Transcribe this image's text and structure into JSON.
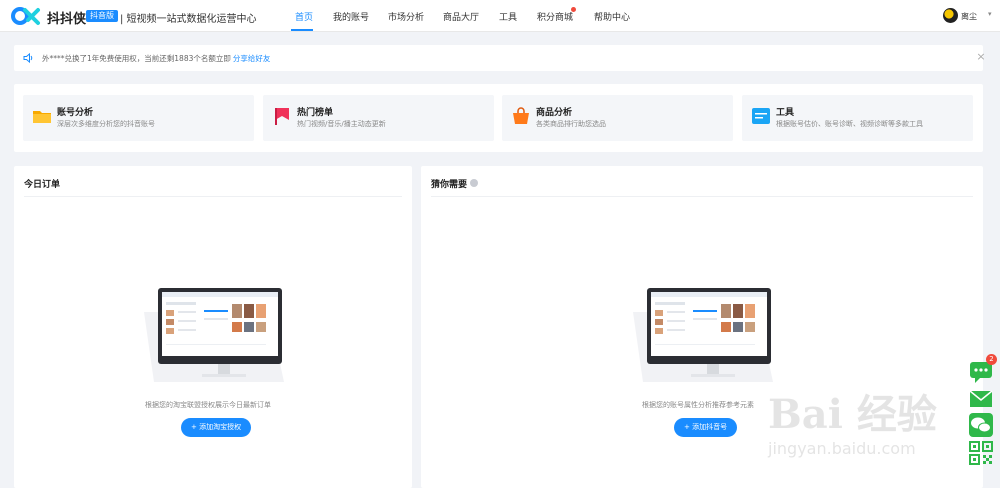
{
  "header": {
    "brand": "抖抖侠",
    "badge": "抖音版",
    "slogan": "| 短视频一站式数据化运营中心",
    "nav": [
      {
        "label": "首页"
      },
      {
        "label": "我的账号"
      },
      {
        "label": "市场分析"
      },
      {
        "label": "商品大厅"
      },
      {
        "label": "工具"
      },
      {
        "label": "积分商城"
      },
      {
        "label": "帮助中心"
      }
    ],
    "active_nav": "首页",
    "user_name": "离尘",
    "caret": "▾",
    "accent_color": "#1a8cff"
  },
  "notice": {
    "text": "外****兑换了1年免费使用权，当前还剩1883个名额立即",
    "link": "分享给好友",
    "close": "×"
  },
  "features": [
    {
      "title": "账号分析",
      "desc": "深层次多维度分析您的抖音账号",
      "icon": "folder-icon"
    },
    {
      "title": "热门榜单",
      "desc": "热门视频/音乐/播主动态更新",
      "icon": "flag-icon"
    },
    {
      "title": "商品分析",
      "desc": "各类商品排行助您选品",
      "icon": "shopping-bag-icon"
    },
    {
      "title": "工具",
      "desc": "根据账号估价、账号诊断、视频诊断等多款工具",
      "icon": "toolbox-icon"
    }
  ],
  "panels": {
    "orders": {
      "title": "今日订单",
      "empty_text": "根据您的淘宝联盟授权展示今日最新订单",
      "button": "+ 添加淘宝授权"
    },
    "guess": {
      "title": "猜你需要",
      "empty_text": "根据您的账号属性分析推荐参考元素",
      "button": "+ 添加抖音号"
    }
  },
  "sidebar": {
    "badge_count": "2",
    "items": [
      "chat-icon",
      "mail-icon",
      "wechat-icon",
      "qrcode-icon"
    ]
  },
  "watermark": {
    "title": "Bai 经验",
    "url": "jingyan.baidu.com"
  }
}
